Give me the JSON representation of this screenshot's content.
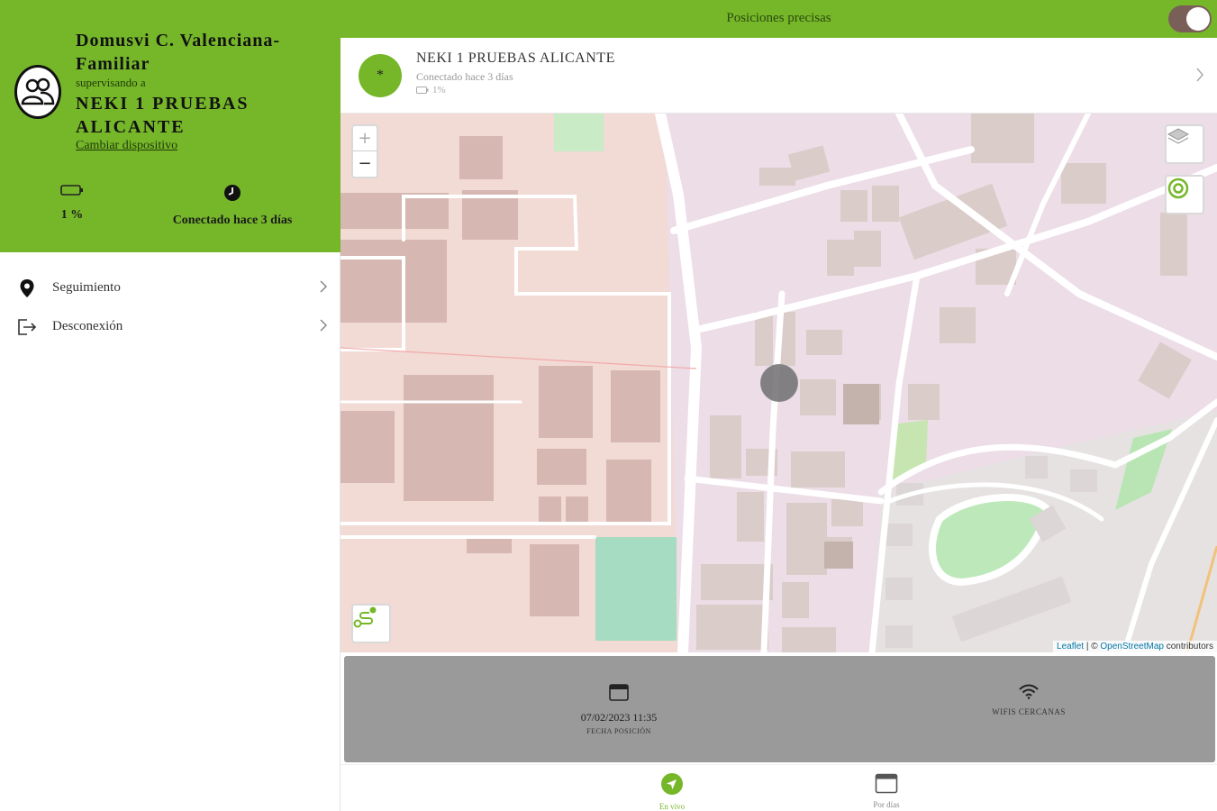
{
  "sidebar": {
    "org_name": "Domusvi C. Valenciana-Familiar",
    "supervising_label": "supervisando a",
    "device_name": "NEKI 1 PRUEBAS ALICANTE",
    "change_device": "Cambiar dispositivo",
    "battery": {
      "value": "1 %",
      "icon": "battery-icon"
    },
    "connection": {
      "value": "Conectado hace 3 días",
      "icon": "clock-icon"
    },
    "menu": [
      {
        "label": "Seguimiento",
        "icon": "location-pin-icon"
      },
      {
        "label": "Desconexión",
        "icon": "logout-icon"
      }
    ]
  },
  "header": {
    "title": "Posiciones precisas",
    "toggle_on": true
  },
  "device": {
    "initial": "*",
    "name": "NEKI 1 PRUEBAS ALICANTE",
    "status": "Conectado hace 3 días",
    "battery": "1%"
  },
  "map": {
    "zoom_in": "+",
    "zoom_out": "−",
    "attribution": {
      "leaflet": "Leaflet",
      "separator": " | © ",
      "osm": "OpenStreetMap",
      "suffix": " contributors"
    }
  },
  "info": {
    "date_value": "07/02/2023 11:35",
    "date_label": "FECHA POSICIÓN",
    "wifi_label": "WIFIS CERCANAS"
  },
  "bottom_nav": [
    {
      "label": "En vivo",
      "icon": "navigation-arrow-icon",
      "active": true
    },
    {
      "label": "Por días",
      "icon": "calendar-icon",
      "active": false
    }
  ],
  "colors": {
    "brand_green": "#76b72a",
    "info_panel": "#9a9a9a",
    "toggle_track": "#7a5e58"
  }
}
